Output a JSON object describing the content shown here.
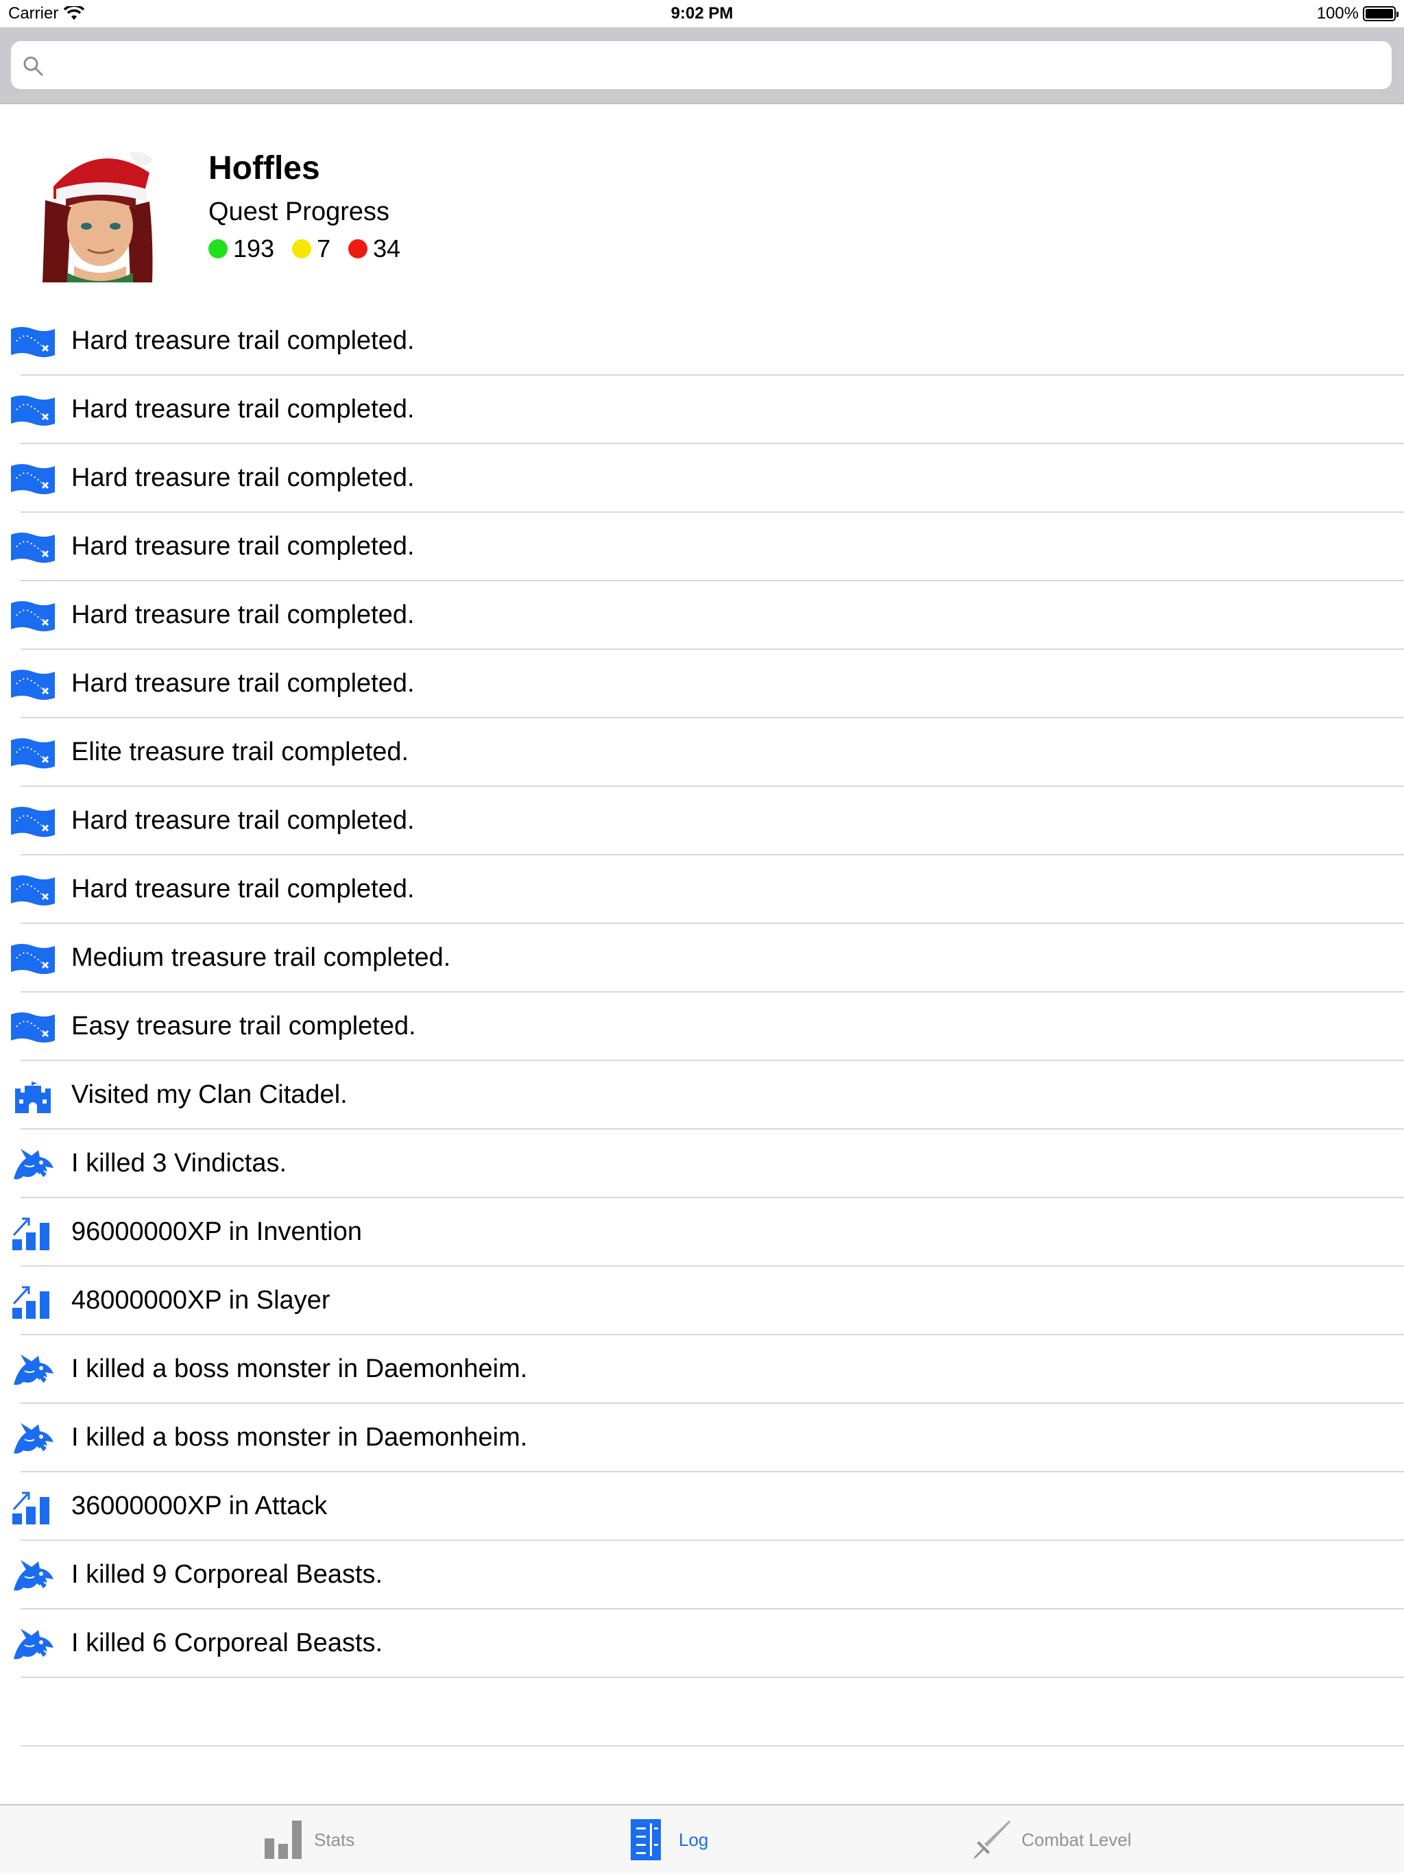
{
  "status_bar": {
    "carrier": "Carrier",
    "time": "9:02 PM",
    "battery": "100%"
  },
  "search": {
    "placeholder": "",
    "value": ""
  },
  "profile": {
    "name": "Hoffles",
    "quest_title": "Quest Progress",
    "quest_stats": [
      {
        "color": "#22e01c",
        "value": "193"
      },
      {
        "color": "#f7e700",
        "value": "7"
      },
      {
        "color": "#ef1a12",
        "value": "34"
      }
    ]
  },
  "accent_color": "#1a6cf0",
  "log": [
    {
      "icon": "treasure-map-icon",
      "text": "Hard treasure trail completed."
    },
    {
      "icon": "treasure-map-icon",
      "text": "Hard treasure trail completed."
    },
    {
      "icon": "treasure-map-icon",
      "text": "Hard treasure trail completed."
    },
    {
      "icon": "treasure-map-icon",
      "text": "Hard treasure trail completed."
    },
    {
      "icon": "treasure-map-icon",
      "text": "Hard treasure trail completed."
    },
    {
      "icon": "treasure-map-icon",
      "text": "Hard treasure trail completed."
    },
    {
      "icon": "treasure-map-icon",
      "text": "Elite treasure trail completed."
    },
    {
      "icon": "treasure-map-icon",
      "text": "Hard treasure trail completed."
    },
    {
      "icon": "treasure-map-icon",
      "text": "Hard treasure trail completed."
    },
    {
      "icon": "treasure-map-icon",
      "text": "Medium treasure trail completed."
    },
    {
      "icon": "treasure-map-icon",
      "text": "Easy treasure trail completed."
    },
    {
      "icon": "castle-icon",
      "text": "Visited my Clan Citadel."
    },
    {
      "icon": "dragon-icon",
      "text": "I killed 3 Vindictas."
    },
    {
      "icon": "xp-chart-icon",
      "text": "96000000XP in Invention"
    },
    {
      "icon": "xp-chart-icon",
      "text": "48000000XP in Slayer"
    },
    {
      "icon": "dragon-icon",
      "text": "I killed a boss monster in Daemonheim."
    },
    {
      "icon": "dragon-icon",
      "text": "I killed a boss monster in Daemonheim."
    },
    {
      "icon": "xp-chart-icon",
      "text": "36000000XP in Attack"
    },
    {
      "icon": "dragon-icon",
      "text": "I killed 9 Corporeal Beasts."
    },
    {
      "icon": "dragon-icon",
      "text": "I killed 6 Corporeal Beasts."
    }
  ],
  "tabs": [
    {
      "label": "Stats",
      "icon": "stats-icon",
      "active": false
    },
    {
      "label": "Log",
      "icon": "log-icon",
      "active": true
    },
    {
      "label": "Combat Level",
      "icon": "sword-icon",
      "active": false
    }
  ]
}
